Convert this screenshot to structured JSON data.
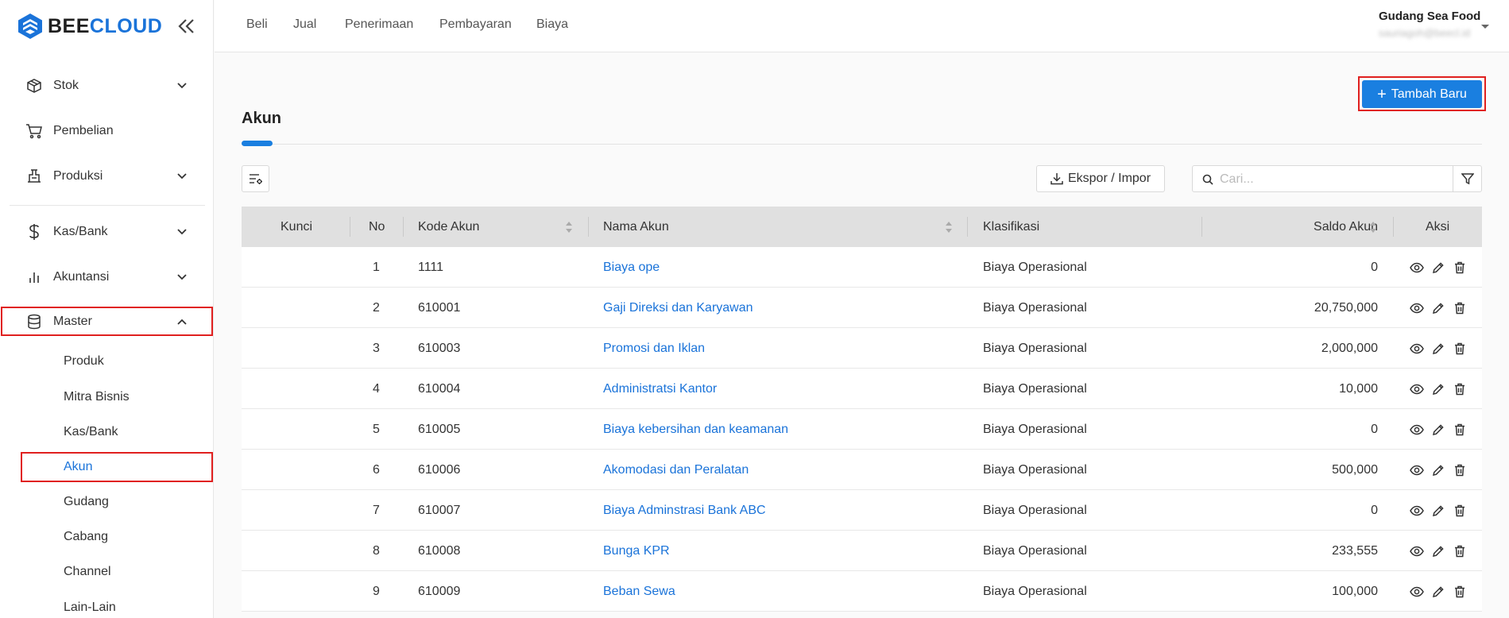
{
  "brand": {
    "name_part1": "BEE",
    "name_part2": "CLOUD",
    "accent_color": "#1a73d9"
  },
  "sidebar": {
    "items": [
      {
        "label": "Stok",
        "icon": "box-icon",
        "has_chevron": true
      },
      {
        "label": "Pembelian",
        "icon": "cart-icon",
        "has_chevron": false
      },
      {
        "label": "Produksi",
        "icon": "factory-icon",
        "has_chevron": true
      },
      {
        "label": "Kas/Bank",
        "icon": "dollar-icon",
        "has_chevron": true
      },
      {
        "label": "Akuntansi",
        "icon": "bar-chart-icon",
        "has_chevron": true
      },
      {
        "label": "Master",
        "icon": "database-icon",
        "has_chevron": true,
        "expanded": true
      }
    ],
    "master_submenu": [
      "Produk",
      "Mitra Bisnis",
      "Kas/Bank",
      "Akun",
      "Gudang",
      "Cabang",
      "Channel",
      "Lain-Lain"
    ],
    "active_submenu": "Akun"
  },
  "topnav": [
    "Beli",
    "Jual",
    "Penerimaan",
    "Pembayaran",
    "Biaya"
  ],
  "user": {
    "name": "Gudang Sea Food",
    "email": "sauriagoh@beecl.id"
  },
  "page": {
    "title": "Akun",
    "add_button": "Tambah Baru",
    "export_button": "Ekspor / Impor",
    "search_placeholder": "Cari..."
  },
  "table": {
    "headers": [
      "Kunci",
      "No",
      "Kode Akun",
      "Nama Akun",
      "Klasifikasi",
      "Saldo Akun",
      "Aksi"
    ],
    "rows": [
      {
        "no": "1",
        "kode": "1111",
        "nama": "Biaya ope",
        "klasifikasi": "Biaya Operasional",
        "saldo": "0"
      },
      {
        "no": "2",
        "kode": "610001",
        "nama": "Gaji Direksi dan Karyawan",
        "klasifikasi": "Biaya Operasional",
        "saldo": "20,750,000"
      },
      {
        "no": "3",
        "kode": "610003",
        "nama": "Promosi dan Iklan",
        "klasifikasi": "Biaya Operasional",
        "saldo": "2,000,000"
      },
      {
        "no": "4",
        "kode": "610004",
        "nama": "Administratsi Kantor",
        "klasifikasi": "Biaya Operasional",
        "saldo": "10,000"
      },
      {
        "no": "5",
        "kode": "610005",
        "nama": "Biaya kebersihan dan keamanan",
        "klasifikasi": "Biaya Operasional",
        "saldo": "0"
      },
      {
        "no": "6",
        "kode": "610006",
        "nama": "Akomodasi dan Peralatan",
        "klasifikasi": "Biaya Operasional",
        "saldo": "500,000"
      },
      {
        "no": "7",
        "kode": "610007",
        "nama": "Biaya Adminstrasi Bank ABC",
        "klasifikasi": "Biaya Operasional",
        "saldo": "0"
      },
      {
        "no": "8",
        "kode": "610008",
        "nama": "Bunga KPR",
        "klasifikasi": "Biaya Operasional",
        "saldo": "233,555"
      },
      {
        "no": "9",
        "kode": "610009",
        "nama": "Beban Sewa",
        "klasifikasi": "Biaya Operasional",
        "saldo": "100,000"
      }
    ]
  }
}
